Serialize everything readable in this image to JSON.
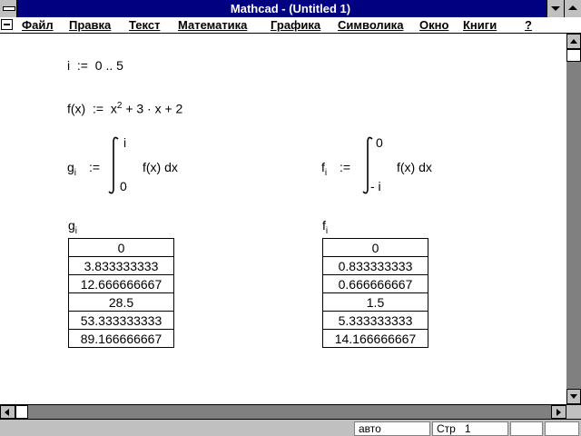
{
  "window": {
    "title": "Mathcad - (Untitled 1)"
  },
  "menu": [
    "Файл",
    "Правка",
    "Текст",
    "Математика",
    "Графика",
    "Символика",
    "Окно",
    "Книги",
    "?"
  ],
  "worksheet": {
    "range_var": "i",
    "range_def": "0 .. 5",
    "func_name": "f(x)",
    "func_def_a": "x",
    "func_def_exp": "2",
    "func_def_b": "+ 3 · x + 2",
    "g": {
      "name": "g",
      "sub": "i",
      "upper": "i",
      "lower": "0",
      "integrand": "f(x) dx"
    },
    "f": {
      "name": "f",
      "sub": "i",
      "upper": "0",
      "lower": "- i",
      "integrand": "f(x) dx"
    },
    "g_values": [
      "0",
      "3.833333333",
      "12.666666667",
      "28.5",
      "53.333333333",
      "89.166666667"
    ],
    "f_values": [
      "0",
      "0.833333333",
      "0.666666667",
      "1.5",
      "5.333333333",
      "14.166666667"
    ]
  },
  "status": {
    "mode": "авто",
    "page": "Стр   1"
  }
}
